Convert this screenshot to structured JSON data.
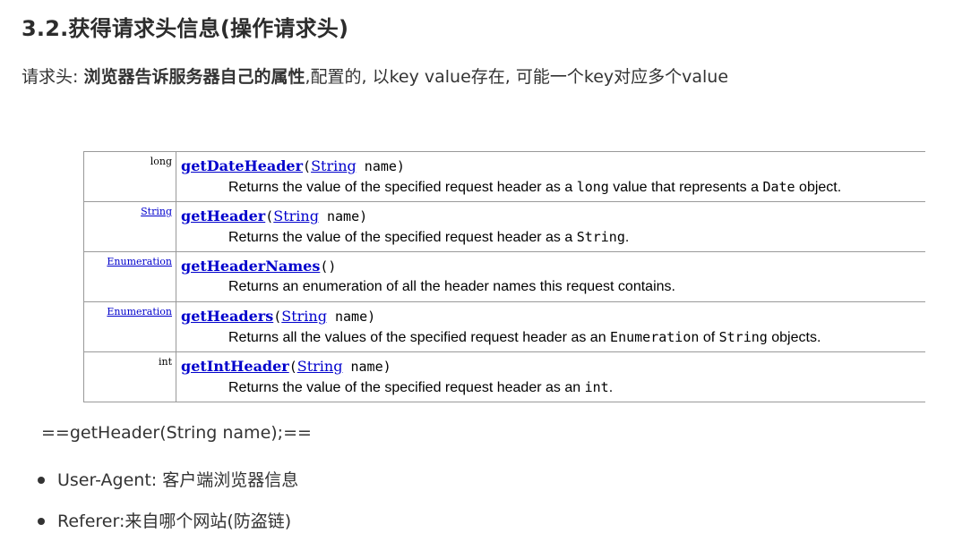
{
  "heading": "3.2.获得请求头信息(操作请求头)",
  "intro": {
    "prefix": "请求头: ",
    "bold": "浏览器告诉服务器自己的属性",
    "suffix": ",配置的, 以key value存在, 可能一个key对应多个value"
  },
  "api_rows": [
    {
      "return_type": "long",
      "return_type_link": false,
      "method": "getDateHeader",
      "open": "(",
      "param_type": "String",
      "param_name": " name)",
      "desc_parts": [
        {
          "t": "Returns the value of the specified request header as a ",
          "code": false
        },
        {
          "t": "long",
          "code": true
        },
        {
          "t": " value that represents a ",
          "code": false
        },
        {
          "t": "Date",
          "code": true
        },
        {
          "t": " object.",
          "code": false
        }
      ]
    },
    {
      "return_type": "String",
      "return_type_link": true,
      "method": "getHeader",
      "open": "(",
      "param_type": "String",
      "param_name": " name)",
      "desc_parts": [
        {
          "t": "Returns the value of the specified request header as a ",
          "code": false
        },
        {
          "t": "String",
          "code": true
        },
        {
          "t": ".",
          "code": false
        }
      ]
    },
    {
      "return_type": "Enumeration",
      "return_type_link": true,
      "method": "getHeaderNames",
      "open": "()",
      "param_type": "",
      "param_name": "",
      "desc_parts": [
        {
          "t": "Returns an enumeration of all the header names this request contains.",
          "code": false
        }
      ]
    },
    {
      "return_type": "Enumeration",
      "return_type_link": true,
      "method": "getHeaders",
      "open": "(",
      "param_type": "String",
      "param_name": " name)",
      "desc_parts": [
        {
          "t": "Returns all the values of the specified request header as an ",
          "code": false
        },
        {
          "t": "Enumeration",
          "code": true
        },
        {
          "t": " of ",
          "code": false
        },
        {
          "t": "String",
          "code": true
        },
        {
          "t": " objects.",
          "code": false
        }
      ]
    },
    {
      "return_type": "int",
      "return_type_link": false,
      "method": "getIntHeader",
      "open": "(",
      "param_type": "String",
      "param_name": " name)",
      "desc_parts": [
        {
          "t": "Returns the value of the specified request header as an ",
          "code": false
        },
        {
          "t": "int",
          "code": true
        },
        {
          "t": ".",
          "code": false
        }
      ]
    }
  ],
  "note": "==getHeader(String name);==",
  "bullets": [
    "User-Agent: 客户端浏览器信息",
    "Referer:来自哪个网站(防盗链)"
  ],
  "colors": {
    "link": "#0000cc",
    "text": "#333333",
    "border": "#999999"
  }
}
